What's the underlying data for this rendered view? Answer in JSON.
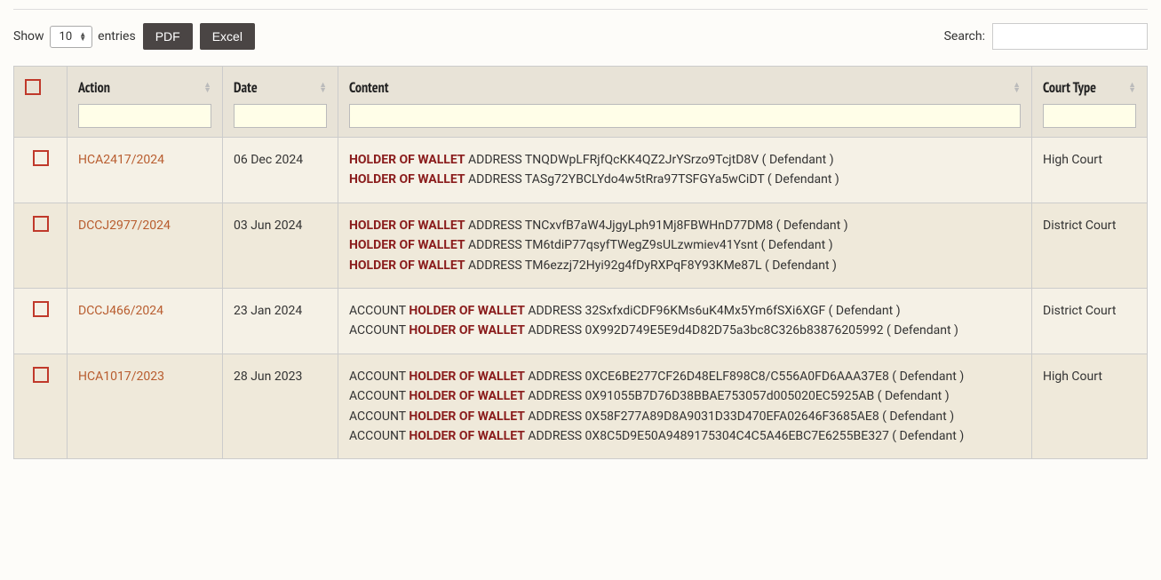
{
  "toolbar": {
    "show_label": "Show",
    "entries_label": "entries",
    "entries_value": "10",
    "pdf_label": "PDF",
    "excel_label": "Excel",
    "search_label": "Search:",
    "search_value": ""
  },
  "columns": {
    "action": "Action",
    "date": "Date",
    "content": "Content",
    "court_type": "Court Type"
  },
  "rows": [
    {
      "action": "HCA2417/2024",
      "date": "06 Dec 2024",
      "court": "High Court",
      "content": [
        {
          "prefix": "",
          "hl": "HOLDER OF WALLET",
          "rest": " ADDRESS TNQDWpLFRjfQcKK4QZ2JrYSrzo9TcjtD8V ( Defendant )"
        },
        {
          "prefix": "",
          "hl": "HOLDER OF WALLET",
          "rest": " ADDRESS TASg72YBCLYdo4w5tRra97TSFGYa5wCiDT ( Defendant )"
        }
      ]
    },
    {
      "action": "DCCJ2977/2024",
      "date": "03 Jun 2024",
      "court": "District Court",
      "content": [
        {
          "prefix": "",
          "hl": "HOLDER OF WALLET",
          "rest": " ADDRESS TNCxvfB7aW4JjgyLph91Mj8FBWHnD77DM8 ( Defendant )"
        },
        {
          "prefix": "",
          "hl": "HOLDER OF WALLET",
          "rest": " ADDRESS TM6tdiP77qsyfTWegZ9sULzwmiev41Ysnt ( Defendant )"
        },
        {
          "prefix": "",
          "hl": "HOLDER OF WALLET",
          "rest": " ADDRESS TM6ezzj72Hyi92g4fDyRXPqF8Y93KMe87L ( Defendant )"
        }
      ]
    },
    {
      "action": "DCCJ466/2024",
      "date": "23 Jan 2024",
      "court": "District Court",
      "content": [
        {
          "prefix": "ACCOUNT ",
          "hl": "HOLDER OF WALLET",
          "rest": " ADDRESS 32SxfxdiCDF96KMs6uK4Mx5Ym6fSXi6XGF ( Defendant )"
        },
        {
          "prefix": "ACCOUNT ",
          "hl": "HOLDER OF WALLET",
          "rest": " ADDRESS 0X992D749E5E9d4D82D75a3bc8C326b83876205992 ( Defendant )"
        }
      ]
    },
    {
      "action": "HCA1017/2023",
      "date": "28 Jun 2023",
      "court": "High Court",
      "content": [
        {
          "prefix": "ACCOUNT ",
          "hl": "HOLDER OF WALLET",
          "rest": " ADDRESS 0XCE6BE277CF26D48ELF898C8/C556A0FD6AAA37E8 ( Defendant )"
        },
        {
          "prefix": "ACCOUNT ",
          "hl": "HOLDER OF WALLET",
          "rest": " ADDRESS 0X91055B7D76D38BBAE753057d005020EC5925AB ( Defendant )"
        },
        {
          "prefix": "ACCOUNT ",
          "hl": "HOLDER OF WALLET",
          "rest": " ADDRESS 0X58F277A89D8A9031D33D470EFA02646F3685AE8 ( Defendant )"
        },
        {
          "prefix": "ACCOUNT ",
          "hl": "HOLDER OF WALLET",
          "rest": " ADDRESS 0X8C5D9E50A9489175304C4C5A46EBC7E6255BE327 ( Defendant )"
        }
      ]
    }
  ]
}
